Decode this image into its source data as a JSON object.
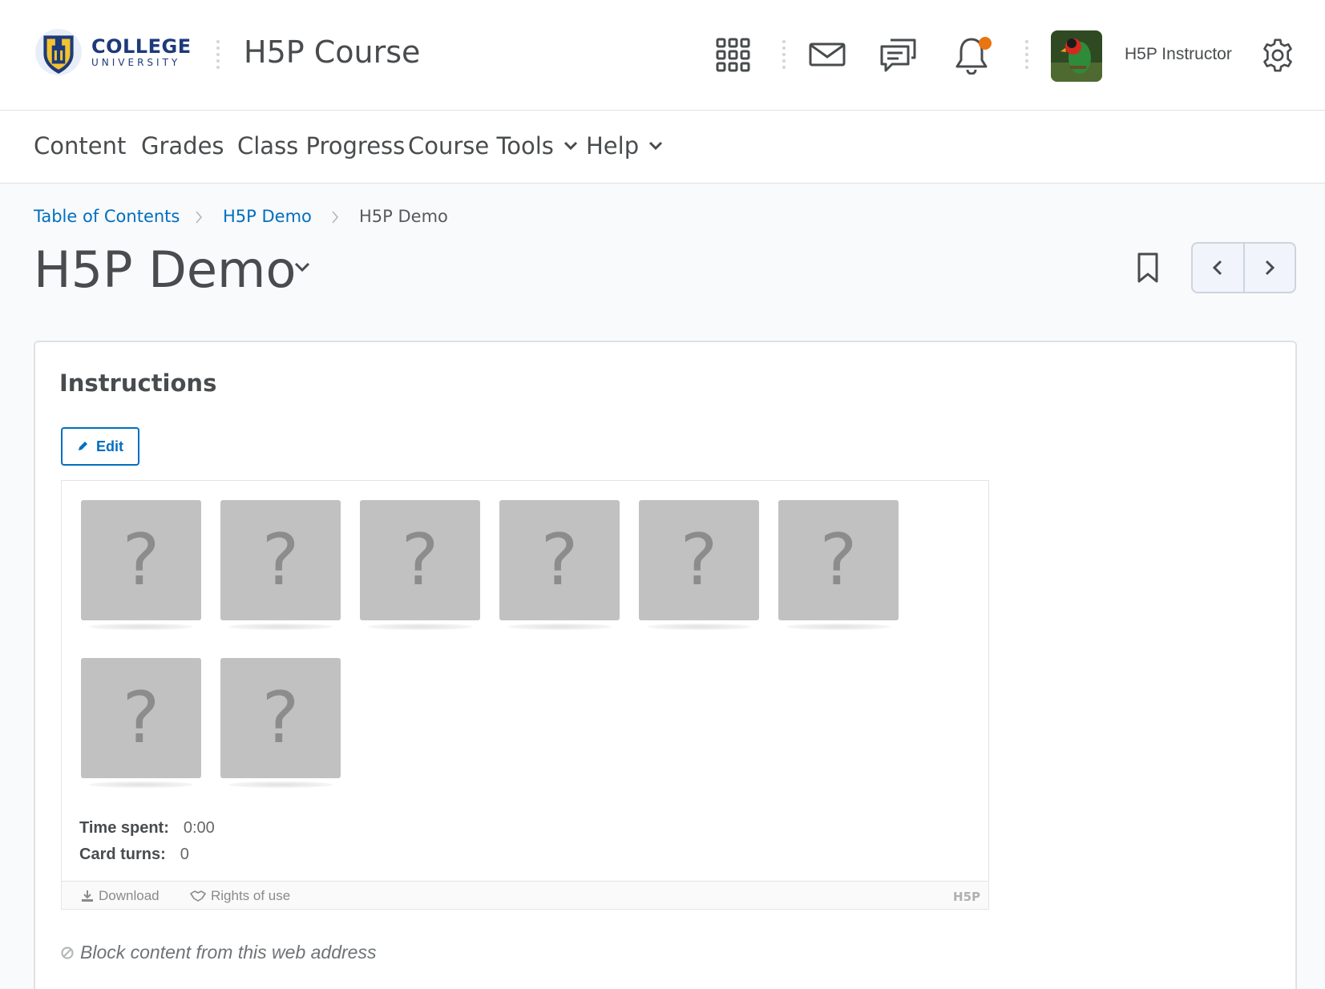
{
  "header": {
    "logo": {
      "line1": "COLLEGE",
      "line2": "UNIVERSITY"
    },
    "course_title": "H5P Course",
    "user_name": "H5P Instructor",
    "icons": [
      "apps-grid-icon",
      "mail-icon",
      "chat-icon",
      "bell-icon",
      "settings-gear-icon"
    ],
    "notification_color": "#e87511"
  },
  "nav": {
    "items": [
      {
        "label": "Content"
      },
      {
        "label": "Grades"
      },
      {
        "label": "Class Progress"
      },
      {
        "label": "Course Tools",
        "has_dropdown": true
      },
      {
        "label": "Help",
        "has_dropdown": true
      }
    ]
  },
  "breadcrumb": {
    "items": [
      {
        "label": "Table of Contents",
        "link": true
      },
      {
        "label": "H5P Demo",
        "link": true
      },
      {
        "label": "H5P Demo",
        "link": false
      }
    ]
  },
  "page": {
    "title": "H5P Demo"
  },
  "card": {
    "heading": "Instructions",
    "edit_label": "Edit",
    "memory_game": {
      "cards": [
        "?",
        "?",
        "?",
        "?",
        "?",
        "?",
        "?",
        "?"
      ],
      "time_spent_label": "Time spent:",
      "time_spent_value": "0:00",
      "card_turns_label": "Card turns:",
      "card_turns_value": "0"
    },
    "footer": {
      "download_label": "Download",
      "rights_label": "Rights of use",
      "brand": "H5P"
    },
    "block_label": "Block content from this web address"
  },
  "colors": {
    "link": "#006fbf",
    "text": "#494c4e",
    "card_back": "#c1c1c1"
  }
}
